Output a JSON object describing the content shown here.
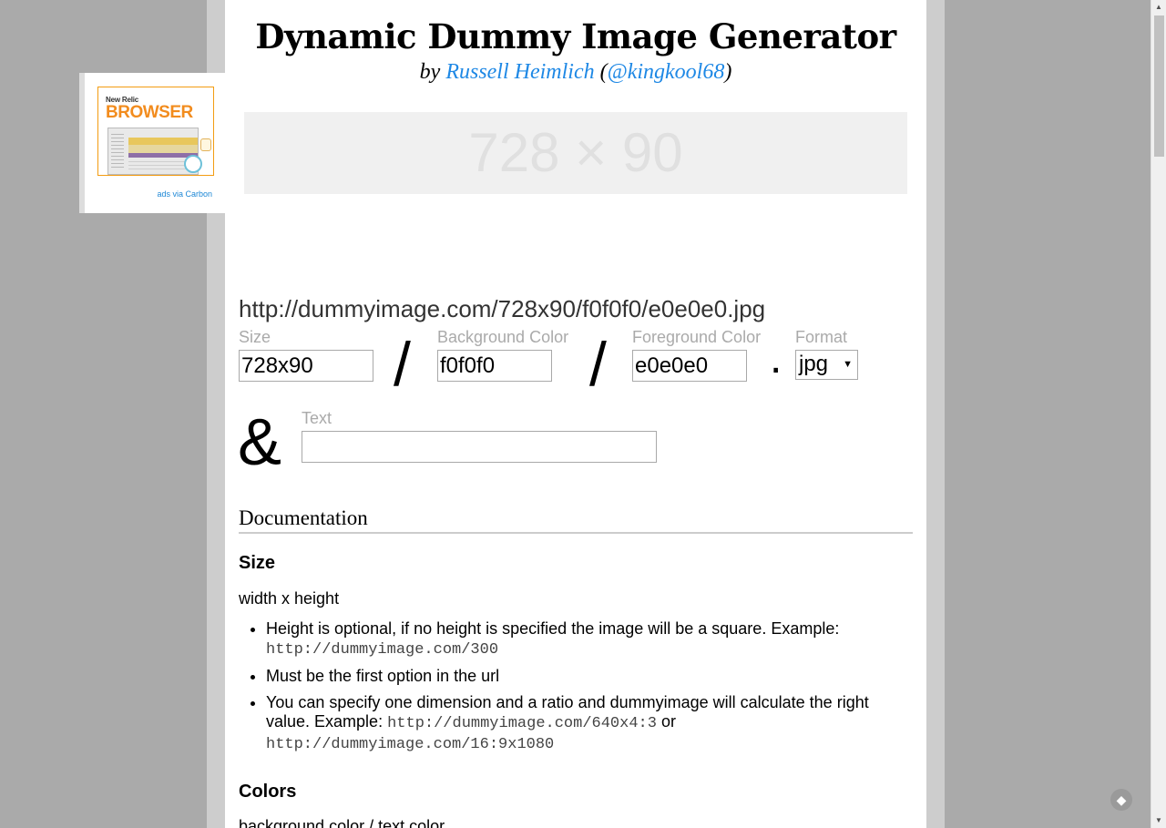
{
  "title": "Dynamic Dummy Image Generator",
  "byline": {
    "prefix": "by",
    "author": "Russell Heimlich",
    "open": "(",
    "handle": "@kingkool68",
    "close": ")"
  },
  "ad": {
    "brand_top": "New Relic",
    "brand": "BROWSER",
    "link": "ads via Carbon"
  },
  "preview": {
    "text": "728 × 90"
  },
  "url": "http://dummyimage.com/728x90/f0f0f0/e0e0e0.jpg",
  "form": {
    "size": {
      "label": "Size",
      "value": "728x90"
    },
    "background": {
      "label": "Background Color",
      "value": "f0f0f0"
    },
    "foreground": {
      "label": "Foreground Color",
      "value": "e0e0e0"
    },
    "format": {
      "label": "Format",
      "value": "jpg",
      "arrow": "▼"
    },
    "text": {
      "label": "Text",
      "value": ""
    },
    "separator_slash": "/",
    "separator_dot": ".",
    "separator_amp": "&"
  },
  "docs": {
    "heading": "Documentation",
    "size": {
      "heading": "Size",
      "desc": "width x height",
      "b1_text": "Height is optional, if no height is specified the image will be a square. Example:",
      "b1_code": "http://dummyimage.com/300",
      "b2_text": "Must be the first option in the url",
      "b3_text": "You can specify one dimension and a ratio and dummyimage will calculate the right value. Example:",
      "b3_code1": "http://dummyimage.com/640x4:3",
      "b3_or": "or",
      "b3_code2": "http://dummyimage.com/16:9x1080"
    },
    "colors": {
      "heading": "Colors",
      "desc": "background color / text color"
    }
  },
  "colors": {
    "link": "#1e88e5",
    "preview_bg": "#f0f0f0",
    "preview_fg": "#e0e0e0",
    "ad_orange": "#f28c1e"
  },
  "icons": {
    "scroll_up": "▲",
    "scroll_down": "▼",
    "feed": "◆"
  }
}
